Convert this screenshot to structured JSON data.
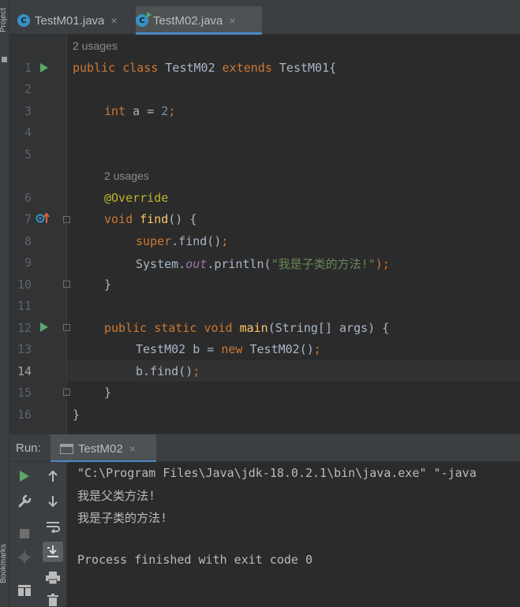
{
  "sidebar": {
    "project_label": "Project",
    "bookmarks_label": "Bookmarks"
  },
  "tabs": [
    {
      "label": "TestM01.java",
      "close": "×",
      "active": false
    },
    {
      "label": "TestM02.java",
      "close": "×",
      "active": true
    }
  ],
  "editor": {
    "hints": [
      "2 usages",
      "2 usages"
    ],
    "line_numbers": [
      "1",
      "2",
      "3",
      "4",
      "5",
      "6",
      "7",
      "8",
      "9",
      "10",
      "11",
      "12",
      "13",
      "14",
      "15",
      "16"
    ],
    "current_line": "14",
    "code": {
      "l1": {
        "kw1": "public",
        "kw2": "class",
        "name": "TestM02",
        "kw3": "extends",
        "parent": "TestM01{"
      },
      "l3": {
        "type": "int",
        "var": "a",
        "eq": "=",
        "num": "2",
        "semi": ";"
      },
      "l6": {
        "ann": "@Override"
      },
      "l7": {
        "kw": "void",
        "fn": "find",
        "rest": "() {"
      },
      "l8": {
        "kw": "super",
        "rest": ".find()",
        "semi": ";"
      },
      "l9": {
        "cls": "System.",
        "fld": "out",
        "call": ".println(",
        "str": "\"我是子类的方法!\"",
        "end": ");"
      },
      "l10": {
        "brace": "}"
      },
      "l12": {
        "kw1": "public",
        "kw2": "static",
        "kw3": "void",
        "fn": "main",
        "rest": "(String[] args) {"
      },
      "l13": {
        "pre": "TestM02 b = ",
        "kw": "new",
        "post": " TestM02()",
        "semi": ";"
      },
      "l14": {
        "pre": "b.find()",
        "semi": ";"
      },
      "l15": {
        "brace": "}"
      },
      "l16": {
        "brace": "}"
      }
    }
  },
  "run_panel": {
    "label": "Run:",
    "tab_label": "TestM02",
    "tab_close": "×",
    "console_lines": [
      "\"C:\\Program Files\\Java\\jdk-18.0.2.1\\bin\\java.exe\" \"-java",
      "我是父类方法!",
      "我是子类的方法!",
      "",
      "Process finished with exit code 0"
    ]
  },
  "colors": {
    "accent": "#4a88c7",
    "run_green": "#59a869",
    "keyword": "#cc7832",
    "number": "#6897bb",
    "function": "#ffc66d",
    "string": "#6a8759",
    "annotation": "#bbb529"
  }
}
